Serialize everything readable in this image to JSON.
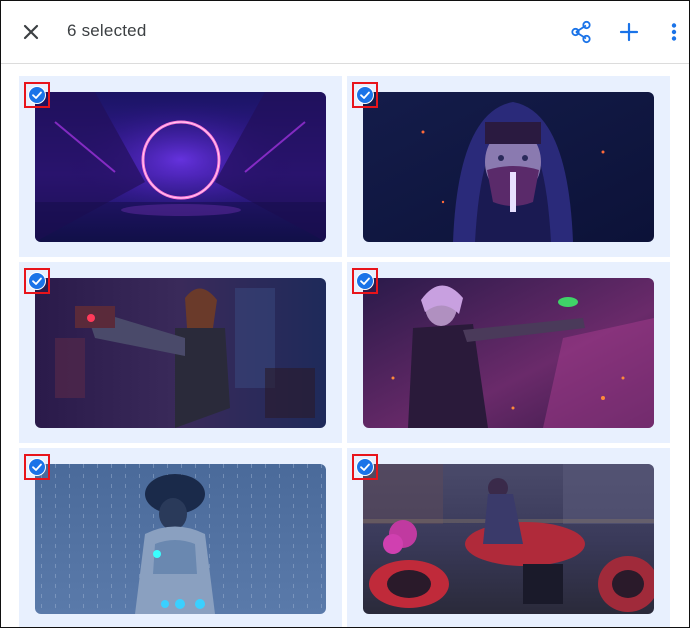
{
  "appbar": {
    "title": "6 selected",
    "accent_color": "#1a73e8",
    "icons": [
      "close-icon",
      "share-icon",
      "add-icon",
      "more-vert-icon"
    ]
  },
  "grid": {
    "selection_color": "#1a73e8",
    "tile_background": "#e8f0fe",
    "photos": [
      {
        "name": "neon-ring-portal",
        "selected": true
      },
      {
        "name": "hooded-masked-woman",
        "selected": true
      },
      {
        "name": "woman-with-gun",
        "selected": true
      },
      {
        "name": "pink-haired-gunner",
        "selected": true
      },
      {
        "name": "cyborg-woman-back",
        "selected": true
      },
      {
        "name": "motorcycle-rider-street",
        "selected": true
      }
    ]
  }
}
